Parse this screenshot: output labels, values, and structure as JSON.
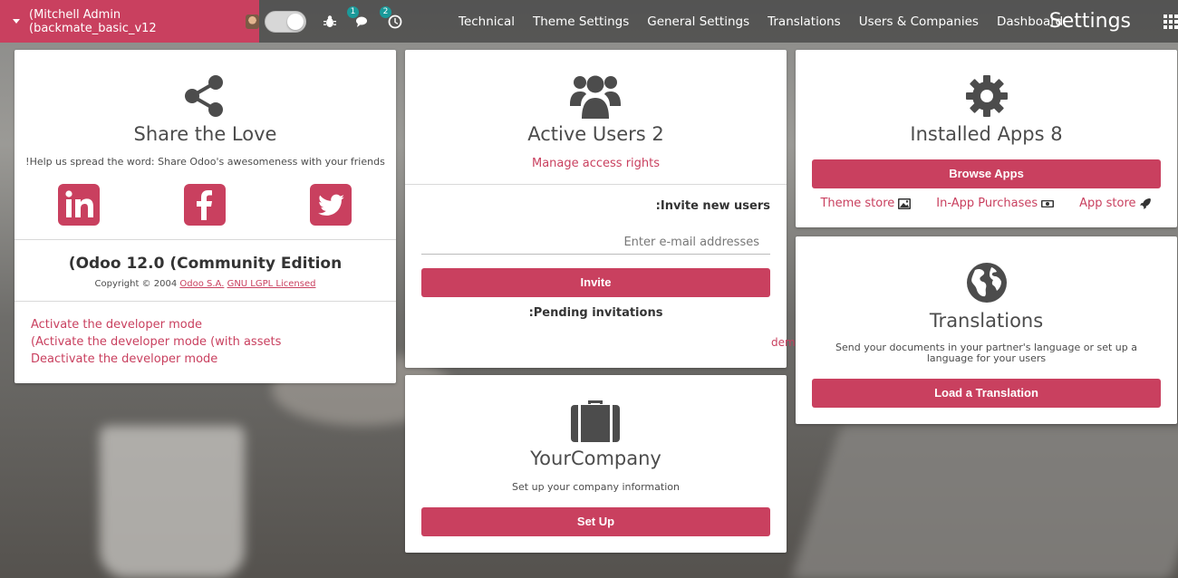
{
  "topbar": {
    "user_label": "(Mitchell Admin (backmate_basic_v12",
    "messages_count": "1",
    "activities_count": "2",
    "nav": [
      "Technical",
      "Theme Settings",
      "General Settings",
      "Translations",
      "Users & Companies",
      "Dashboard"
    ],
    "app_title": "Settings"
  },
  "share": {
    "title": "Share the Love",
    "tagline": "!Help us spread the word: Share Odoo's awesomeness with your friends",
    "version": "(Odoo 12.0 (Community Edition",
    "copyright_prefix": "Copyright © 2004",
    "odoo_link": "Odoo S.A.",
    "license_link": "GNU LGPL Licensed",
    "dev_links": [
      "Activate the developer mode",
      "(Activate the developer mode (with assets",
      "Deactivate the developer mode"
    ]
  },
  "users": {
    "title": "Active Users 2",
    "manage_link": "Manage access rights",
    "invite_label": ":Invite new users",
    "invite_placeholder": "Enter e-mail addresses",
    "invite_button": "Invite",
    "pending_label": ":Pending invitations",
    "pending_user": "demo"
  },
  "company": {
    "title": "YourCompany",
    "subtitle": "Set up your company information",
    "button": "Set Up"
  },
  "apps": {
    "title": "Installed Apps 8",
    "button": "Browse Apps",
    "links": [
      "Theme store",
      "In-App Purchases",
      "App store"
    ]
  },
  "translations": {
    "title": "Translations",
    "subtitle": "Send your documents in your partner's language or set up a language for your users",
    "button": "Load a Translation"
  },
  "colors": {
    "accent": "#c9405f",
    "text": "#4c4c4c",
    "badge": "#1a9a9a"
  }
}
